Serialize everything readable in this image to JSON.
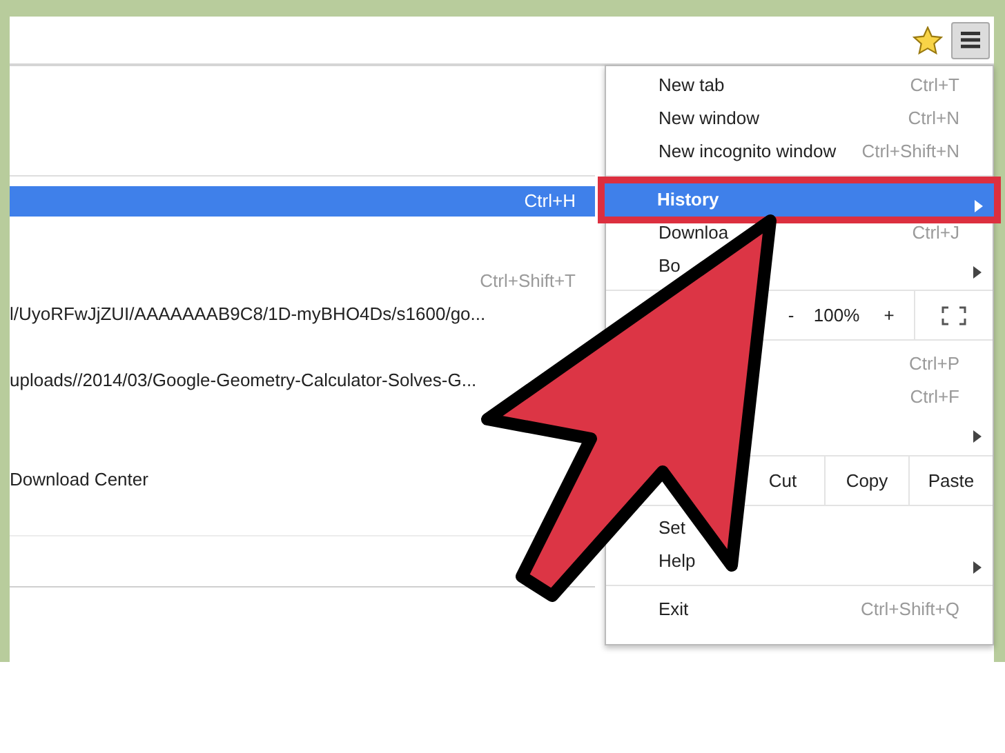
{
  "page_rows": [
    {
      "kind": "highlight",
      "shortcut": "Ctrl+H"
    },
    {
      "kind": "shortcut",
      "shortcut": "Ctrl+Shift+T"
    },
    {
      "kind": "text",
      "text": "l/UyoRFwJjZUI/AAAAAAAB9C8/1D-myBHO4Ds/s1600/go..."
    },
    {
      "kind": "text",
      "text": "uploads//2014/03/Google-Geometry-Calculator-Solves-G..."
    },
    {
      "kind": "text",
      "text": "Download Center"
    }
  ],
  "menu": {
    "items": [
      {
        "kind": "item",
        "label": "New tab",
        "shortcut": "Ctrl+T",
        "submenu": false,
        "selected": false
      },
      {
        "kind": "item",
        "label": "New window",
        "shortcut": "Ctrl+N",
        "submenu": false,
        "selected": false
      },
      {
        "kind": "item",
        "label": "New incognito window",
        "shortcut": "Ctrl+Shift+N",
        "submenu": false,
        "selected": false
      },
      {
        "kind": "separator"
      },
      {
        "kind": "item",
        "label": "History",
        "submenu": true,
        "selected": true
      },
      {
        "kind": "item",
        "label": "Downloa",
        "shortcut": "Ctrl+J",
        "submenu": false,
        "selected": false
      },
      {
        "kind": "item",
        "label": "Bo",
        "submenu": true,
        "selected": false
      },
      {
        "kind": "zoom",
        "minus": "-",
        "value": "100%",
        "plus": "+"
      },
      {
        "kind": "item",
        "shortcut": "Ctrl+P",
        "submenu": false,
        "selected": false
      },
      {
        "kind": "item",
        "shortcut": "Ctrl+F",
        "submenu": false,
        "selected": false
      },
      {
        "kind": "item",
        "submenu": true,
        "selected": false
      },
      {
        "kind": "edit",
        "buttons": [
          "Cut",
          "Copy",
          "Paste"
        ]
      },
      {
        "kind": "item",
        "label": "Set",
        "submenu": false,
        "selected": false
      },
      {
        "kind": "item",
        "label": "Help",
        "submenu": true,
        "selected": false
      },
      {
        "kind": "separator"
      },
      {
        "kind": "item",
        "label": "Exit",
        "shortcut": "Ctrl+Shift+Q",
        "submenu": false,
        "selected": false
      }
    ]
  }
}
